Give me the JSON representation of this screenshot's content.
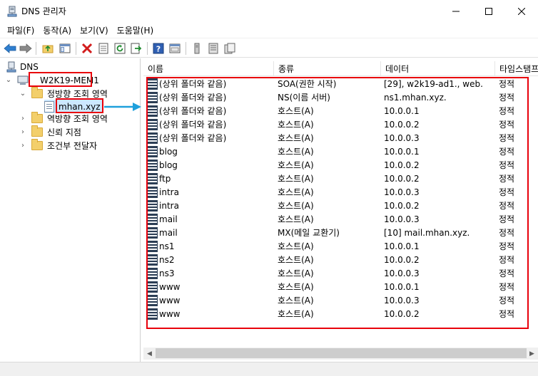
{
  "window": {
    "title": "DNS 관리자",
    "icon": "dns-manager-icon"
  },
  "menu": [
    "파일(F)",
    "동작(A)",
    "보기(V)",
    "도움말(H)"
  ],
  "toolbar_icons": [
    "back-arrow-icon",
    "forward-arrow-icon",
    "up-folder-icon",
    "show-hide-tree-icon",
    "delete-icon",
    "properties-icon",
    "refresh-icon",
    "export-list-icon",
    "help-icon",
    "console-icon",
    "server-icon",
    "list-icon",
    "copy-icon"
  ],
  "tree": {
    "root": "DNS",
    "server": "W2K19-MEM1",
    "forward_zones": "정방향 조회 영역",
    "zone": "mhan.xyz",
    "reverse_zones": "역방향 조회 영역",
    "trust_points": "신뢰 지점",
    "conditional_forwarders": "조건부 전달자"
  },
  "columns": [
    "이름",
    "종류",
    "데이터",
    "타임스탬프"
  ],
  "records": [
    {
      "name": "(상위 폴더와 같음)",
      "type": "SOA(권한 시작)",
      "data": "[29], w2k19-ad1., web.",
      "ts": "정적"
    },
    {
      "name": "(상위 폴더와 같음)",
      "type": "NS(이름 서버)",
      "data": "ns1.mhan.xyz.",
      "ts": "정적"
    },
    {
      "name": "(상위 폴더와 같음)",
      "type": "호스트(A)",
      "data": "10.0.0.1",
      "ts": "정적"
    },
    {
      "name": "(상위 폴더와 같음)",
      "type": "호스트(A)",
      "data": "10.0.0.2",
      "ts": "정적"
    },
    {
      "name": "(상위 폴더와 같음)",
      "type": "호스트(A)",
      "data": "10.0.0.3",
      "ts": "정적"
    },
    {
      "name": "blog",
      "type": "호스트(A)",
      "data": "10.0.0.1",
      "ts": "정적"
    },
    {
      "name": "blog",
      "type": "호스트(A)",
      "data": "10.0.0.2",
      "ts": "정적"
    },
    {
      "name": "ftp",
      "type": "호스트(A)",
      "data": "10.0.0.2",
      "ts": "정적"
    },
    {
      "name": "intra",
      "type": "호스트(A)",
      "data": "10.0.0.3",
      "ts": "정적"
    },
    {
      "name": "intra",
      "type": "호스트(A)",
      "data": "10.0.0.2",
      "ts": "정적"
    },
    {
      "name": "mail",
      "type": "호스트(A)",
      "data": "10.0.0.3",
      "ts": "정적"
    },
    {
      "name": "mail",
      "type": "MX(메일 교환기)",
      "data": "[10]  mail.mhan.xyz.",
      "ts": "정적"
    },
    {
      "name": "ns1",
      "type": "호스트(A)",
      "data": "10.0.0.1",
      "ts": "정적"
    },
    {
      "name": "ns2",
      "type": "호스트(A)",
      "data": "10.0.0.2",
      "ts": "정적"
    },
    {
      "name": "ns3",
      "type": "호스트(A)",
      "data": "10.0.0.3",
      "ts": "정적"
    },
    {
      "name": "www",
      "type": "호스트(A)",
      "data": "10.0.0.1",
      "ts": "정적"
    },
    {
      "name": "www",
      "type": "호스트(A)",
      "data": "10.0.0.3",
      "ts": "정적"
    },
    {
      "name": "www",
      "type": "호스트(A)",
      "data": "10.0.0.2",
      "ts": "정적"
    }
  ],
  "colors": {
    "highlight_red": "#e8000b",
    "arrow_blue": "#1ea0dc",
    "selection": "#cce8ff"
  }
}
